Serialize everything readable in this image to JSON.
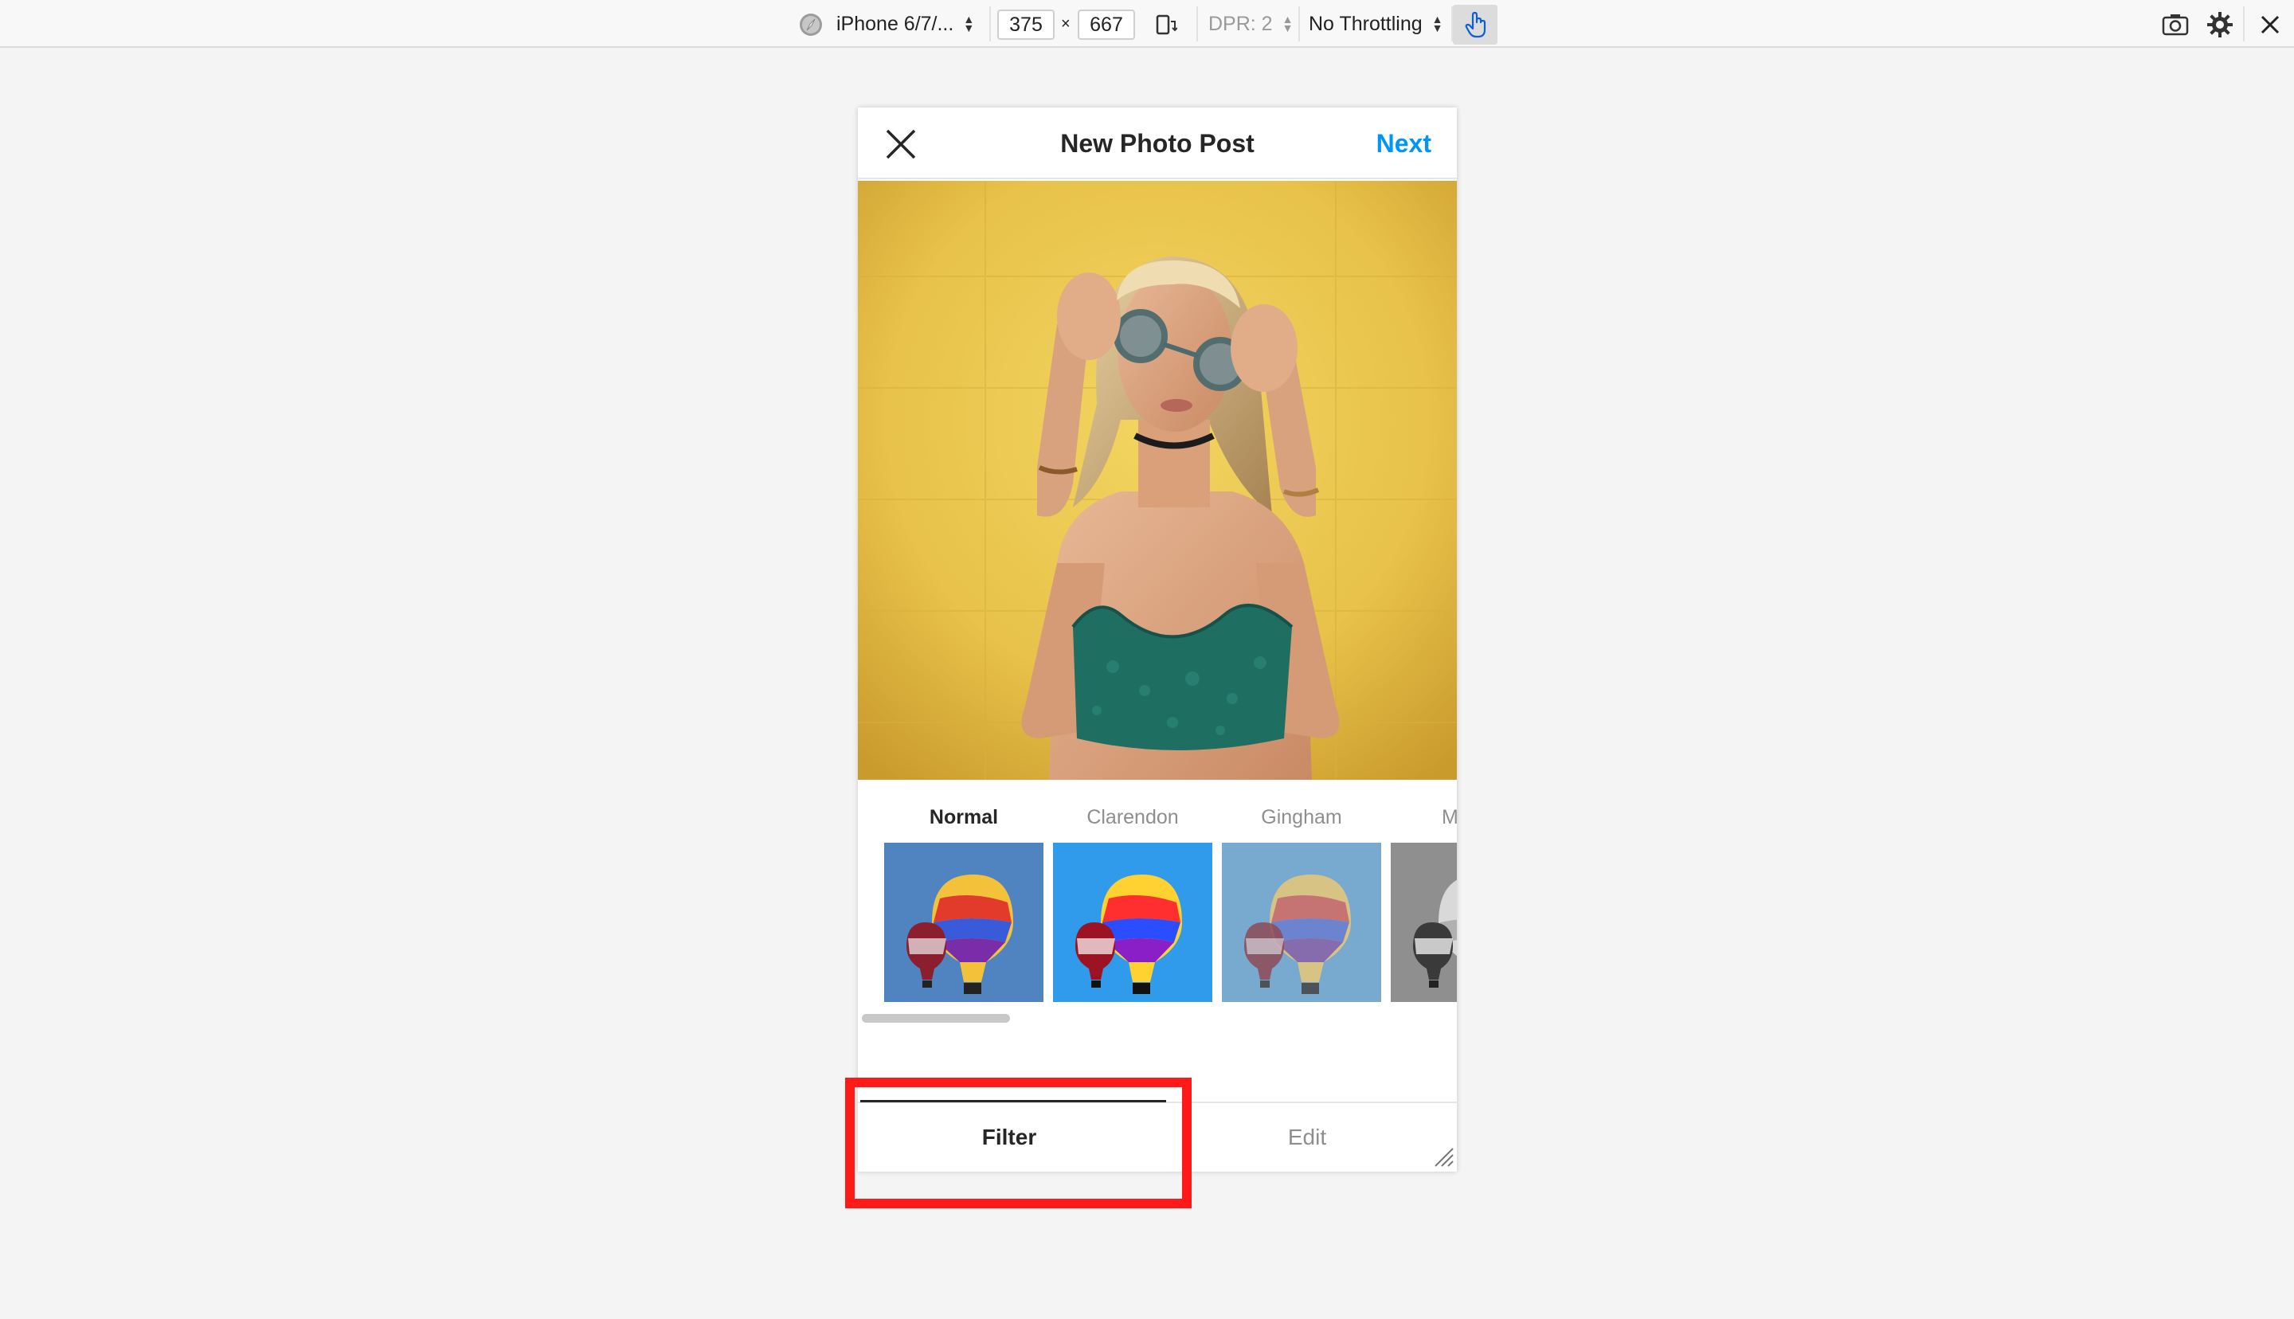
{
  "devtools": {
    "device": "iPhone 6/7/...",
    "width": "375",
    "times": "×",
    "height": "667",
    "dpr": "DPR: 2",
    "throttling": "No Throttling",
    "icons": [
      "compass-icon",
      "rotate-device-icon",
      "touch-icon",
      "camera-icon",
      "gear-icon",
      "close-icon"
    ]
  },
  "post": {
    "title": "New Photo Post",
    "next_label": "Next",
    "close_icon": "close-icon"
  },
  "filters": [
    {
      "label": "Normal",
      "active": true
    },
    {
      "label": "Clarendon",
      "active": false
    },
    {
      "label": "Gingham",
      "active": false
    },
    {
      "label": "M",
      "active": false
    }
  ],
  "tabs": {
    "filter": "Filter",
    "edit": "Edit",
    "active": "filter"
  },
  "colors": {
    "accent": "#0095f6",
    "highlight": "#ff1a1a",
    "photo_bg": "#e8c24a",
    "top_green": "#1f6e62"
  }
}
